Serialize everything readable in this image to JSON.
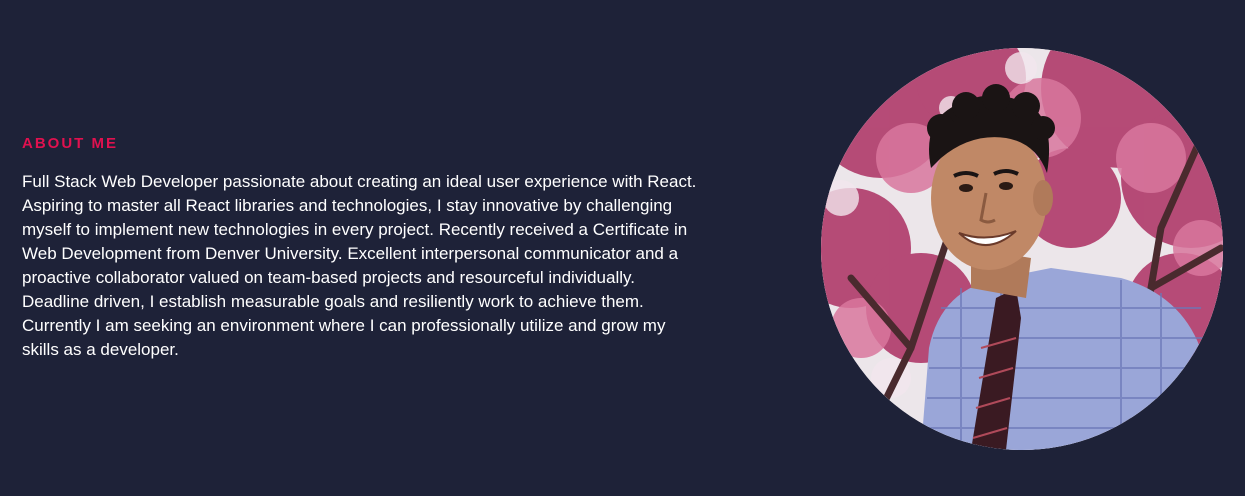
{
  "about": {
    "heading": "ABOUT ME",
    "bio": "Full Stack Web Developer passionate about creating an ideal user experience with React. Aspiring to master all React libraries and technologies, I stay innovative by challenging myself to implement new technologies in every project. Recently received a Certificate in Web Development from Denver University. Excellent interpersonal communicator and a proactive collaborator valued on team-based projects and resourceful individually. Deadline driven, I establish measurable goals and resiliently work to achieve them. Currently I am seeking an environment where I can professionally utilize and grow my skills as a developer."
  },
  "colors": {
    "background": "#1e2238",
    "accent": "#e0114f",
    "text": "#ffffff"
  },
  "photo": {
    "icon": "profile-photo"
  }
}
